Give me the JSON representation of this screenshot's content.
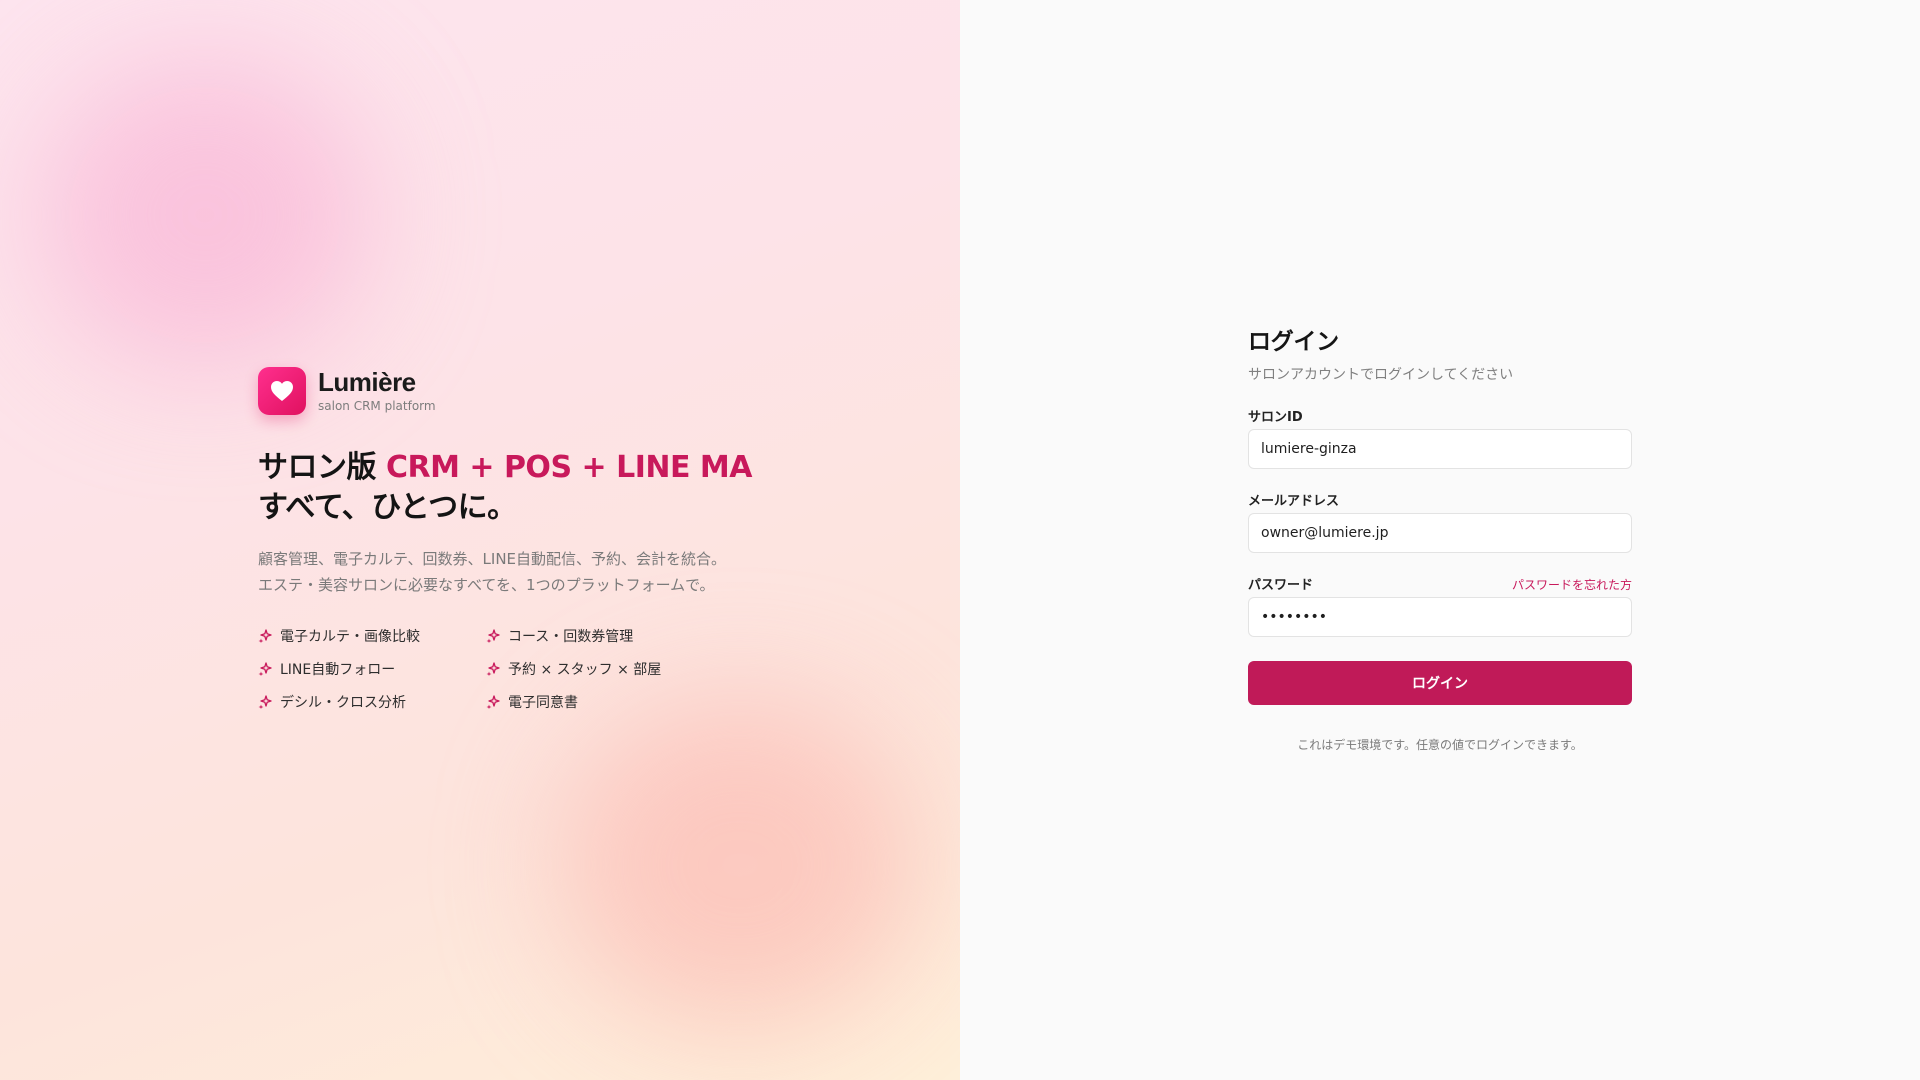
{
  "brand": {
    "name": "Lumière",
    "tagline": "salon CRM platform",
    "logo_icon": "heart-icon",
    "accent_color": "#c8195b"
  },
  "hero": {
    "headline_prefix": "サロン版 ",
    "headline_accent": "CRM + POS + LINE MA",
    "headline_line2": "すべて、ひとつに。",
    "lead_line1": "顧客管理、電子カルテ、回数券、LINE自動配信、予約、会計を統合。",
    "lead_line2": "エステ・美容サロンに必要なすべてを、1つのプラットフォームで。",
    "features": [
      {
        "label": "電子カルテ・画像比較",
        "icon": "sparkle-icon"
      },
      {
        "label": "コース・回数券管理",
        "icon": "sparkle-icon"
      },
      {
        "label": "LINE自動フォロー",
        "icon": "sparkle-icon"
      },
      {
        "label": "予約 × スタッフ × 部屋",
        "icon": "sparkle-icon"
      },
      {
        "label": "デシル・クロス分析",
        "icon": "sparkle-icon"
      },
      {
        "label": "電子同意書",
        "icon": "sparkle-icon"
      }
    ]
  },
  "login": {
    "title": "ログイン",
    "subtitle": "サロンアカウントでログインしてください",
    "salon_id": {
      "label": "サロンID",
      "value": "lumiere-ginza"
    },
    "email": {
      "label": "メールアドレス",
      "value": "owner@lumiere.jp"
    },
    "password": {
      "label": "パスワード",
      "value": "password",
      "forgot_label": "パスワードを忘れた方"
    },
    "submit_label": "ログイン",
    "note": "これはデモ環境です。任意の値でログインできます。",
    "button_color": "#c01a58"
  }
}
